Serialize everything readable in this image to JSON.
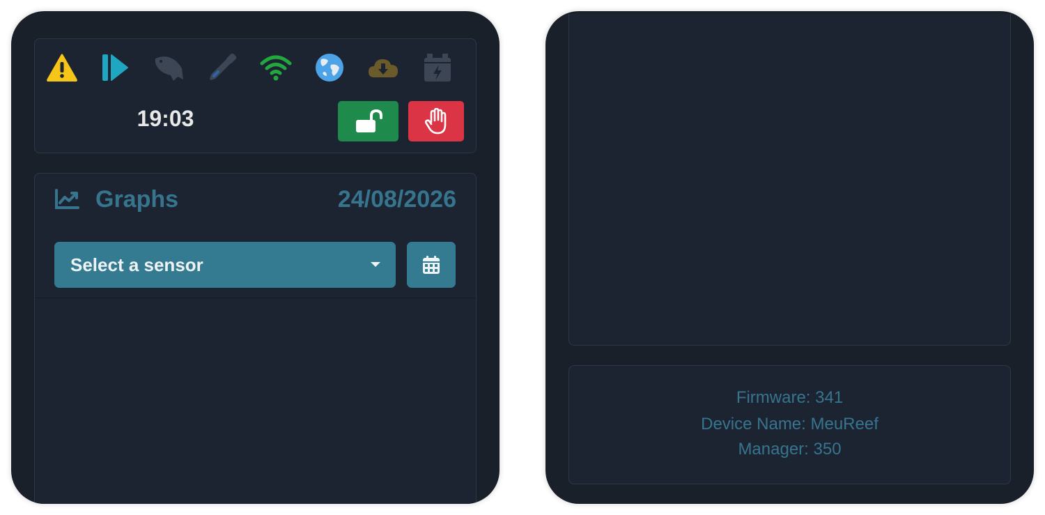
{
  "status_bar": {
    "icons": [
      {
        "name": "warning-icon",
        "color": "#f5c518",
        "active": true
      },
      {
        "name": "play-next-icon",
        "color": "#1fa7c2",
        "active": true
      },
      {
        "name": "fish-icon",
        "color": "#3c4655",
        "active": false
      },
      {
        "name": "dropper-icon",
        "color": "#3c4655",
        "active": false
      },
      {
        "name": "wifi-icon",
        "color": "#22a83c",
        "active": true
      },
      {
        "name": "globe-icon",
        "color": "#4da3e8",
        "active": true
      },
      {
        "name": "cloud-download-icon",
        "color": "#6b5a2a",
        "active": false
      },
      {
        "name": "battery-bolt-icon",
        "color": "#3c4655",
        "active": false
      }
    ],
    "clock": "19:03",
    "lock_button_color": "#1e8a4c",
    "stop_button_color": "#db3445"
  },
  "graphs": {
    "title": "Graphs",
    "date": "24/08/2026",
    "sensor_select": {
      "selected": "Select a sensor"
    },
    "accent_color": "#37758f"
  },
  "device_info": {
    "firmware": "Firmware: 341",
    "device_name": "Device Name: MeuReef",
    "manager": "Manager: 350"
  }
}
